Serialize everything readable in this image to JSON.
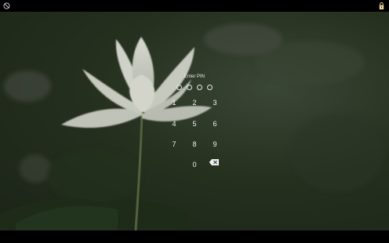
{
  "status_bar": {
    "left_icon": "rotation-lock-icon",
    "right_icon": "lock-icon"
  },
  "lock_screen": {
    "title": "Enter PIN",
    "pin_length": 4,
    "keypad": {
      "keys": [
        "1",
        "2",
        "3",
        "4",
        "5",
        "6",
        "7",
        "8",
        "9",
        "0"
      ],
      "backspace_icon": "backspace-icon"
    }
  },
  "colors": {
    "text": "#f0f0f0",
    "background": "#000000"
  }
}
